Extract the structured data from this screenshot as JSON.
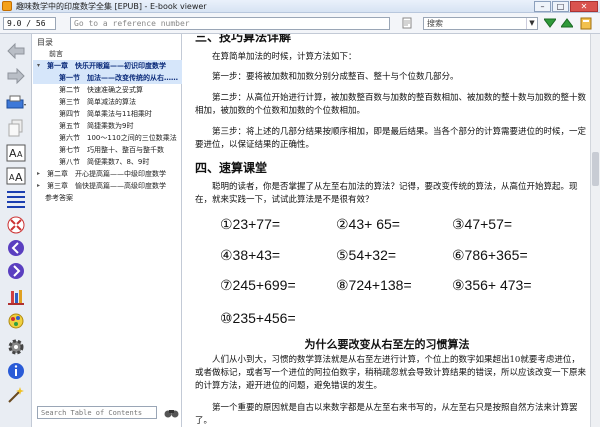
{
  "window": {
    "title": "趣味数学中的印度数学全集 [EPUB] - E-book viewer",
    "controls": {
      "minimize": "–",
      "maximize": "□",
      "close": "✕"
    }
  },
  "toolbar": {
    "page_position": "9.0 / 56",
    "reference_placeholder": "Go to a reference number",
    "search_combo_label": "搜索"
  },
  "toc": {
    "heading": "目录",
    "items": [
      {
        "label": "前言",
        "level": 1,
        "twisty": ""
      },
      {
        "label": "第一章　快乐开眼篇——初识印度数学",
        "level": 0,
        "twisty": "▾",
        "selected": true
      },
      {
        "label": "第一节　加法——改变传统的从右……",
        "level": 2,
        "twisty": "",
        "selected": true
      },
      {
        "label": "第二节　快速准确之妥式算",
        "level": 2,
        "twisty": ""
      },
      {
        "label": "第三节　简单减法的算法",
        "level": 2,
        "twisty": ""
      },
      {
        "label": "第四节　简单乘法与11相乘时",
        "level": 2,
        "twisty": ""
      },
      {
        "label": "第五节　简捷乘数为9时",
        "level": 2,
        "twisty": ""
      },
      {
        "label": "第六节　100～110之间的三位数乘法",
        "level": 2,
        "twisty": ""
      },
      {
        "label": "第七节　巧用整十、整百与整千数",
        "level": 2,
        "twisty": ""
      },
      {
        "label": "第八节　简便乘数7、8、9时",
        "level": 2,
        "twisty": ""
      },
      {
        "label": "第二章　开心提高篇——中级印度数学",
        "level": 0,
        "twisty": "▸"
      },
      {
        "label": "第三章　愉快提高篇——高级印度数学",
        "level": 0,
        "twisty": "▸"
      },
      {
        "label": "参考答案",
        "level": 1,
        "twisty": ""
      }
    ],
    "search_placeholder": "Search Table of Contents"
  },
  "content": {
    "section3_title": "三、技巧算法详解",
    "p1": "在算简单加法的时候，计算方法如下：",
    "p2": "第一步：要将被加数和加数分别分成整百、整十与个位数几部分。",
    "p3": "第二步：从高位开始进行计算，被加数整百数与加数的整百数相加、被加数的整十数与加数的整十数相加，被加数的个位数和加数的个位数相加。",
    "p4": "第三步：将上述的几部分结果按顺序相加，即是最后结果。当各个部分的计算需要进位的时候，一定要进位，以保证结果的正确性。",
    "section4_title": "四、速算课堂",
    "p5": "聪明的读者，你是否掌握了从左至右加法的算法？记得，要改变传统的算法，从高位开始算起。现在，就来实践一下，试试此算法是不是很有效？",
    "problems": [
      "①23+77=",
      "②43+ 65=",
      "③47+57=",
      "④38+43=",
      "⑤54+32=",
      "⑥786+365=",
      "⑦245+699=",
      "⑧724+138=",
      "⑨356+ 473=",
      "⑩235+456="
    ],
    "center_title": "为什么要改变从右至左的习惯算法",
    "p6": "人们从小到大，习惯的数学算法就是从右至左进行计算，个位上的数字如果超出10就要考虑进位，或者做标记，或者写一个进位的阿拉伯数字，稍稍疏忽就会导致计算结果的错误，所以应该改变一下原来的计算方法，避开进位的问题，避免错误的发生。",
    "p7": "第一个重要的原因就是自古以来数字都是从左至右来书写的，从左至右只是按照自然方法来计算罢了。"
  },
  "icons": {
    "back": "back-arrow-icon",
    "forward": "forward-arrow-icon"
  },
  "colors": {
    "accent": "#2a5bd7",
    "find_next": "#2f9a3a",
    "close": "#d9534f"
  }
}
